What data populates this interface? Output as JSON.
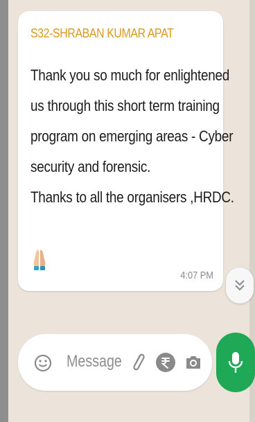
{
  "message": {
    "sender": "S32-SHRABAN KUMAR APAT",
    "lines": [
      "Thank you so much for enlightened",
      "us through this short term training",
      "program  on emerging areas - Cyber",
      "security and forensic.",
      "Thanks to all the  organisers ,HRDC."
    ],
    "emoji": "folded-hands",
    "time": "4:07 PM"
  },
  "composer": {
    "placeholder": "Message",
    "icons": [
      "emoji-icon",
      "attach-icon",
      "rupee-icon",
      "camera-icon",
      "mic-icon"
    ]
  },
  "colors": {
    "chat_background": "#ece4da",
    "sender_name": "#d89a1c",
    "mic_button": "#1fa855"
  }
}
